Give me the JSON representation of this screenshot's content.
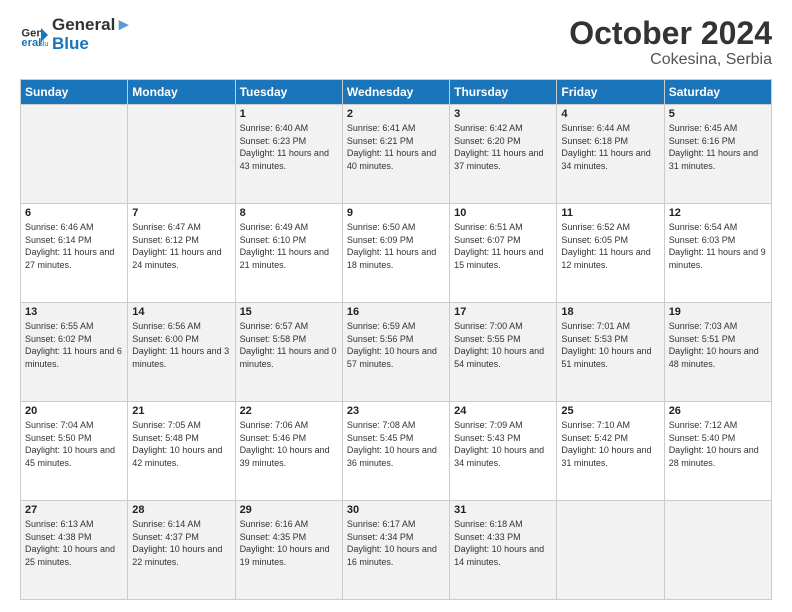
{
  "header": {
    "logo_general": "General",
    "logo_blue": "Blue",
    "month": "October 2024",
    "location": "Cokesina, Serbia"
  },
  "weekdays": [
    "Sunday",
    "Monday",
    "Tuesday",
    "Wednesday",
    "Thursday",
    "Friday",
    "Saturday"
  ],
  "weeks": [
    [
      {
        "day": "",
        "sunrise": "",
        "sunset": "",
        "daylight": ""
      },
      {
        "day": "",
        "sunrise": "",
        "sunset": "",
        "daylight": ""
      },
      {
        "day": "1",
        "sunrise": "Sunrise: 6:40 AM",
        "sunset": "Sunset: 6:23 PM",
        "daylight": "Daylight: 11 hours and 43 minutes."
      },
      {
        "day": "2",
        "sunrise": "Sunrise: 6:41 AM",
        "sunset": "Sunset: 6:21 PM",
        "daylight": "Daylight: 11 hours and 40 minutes."
      },
      {
        "day": "3",
        "sunrise": "Sunrise: 6:42 AM",
        "sunset": "Sunset: 6:20 PM",
        "daylight": "Daylight: 11 hours and 37 minutes."
      },
      {
        "day": "4",
        "sunrise": "Sunrise: 6:44 AM",
        "sunset": "Sunset: 6:18 PM",
        "daylight": "Daylight: 11 hours and 34 minutes."
      },
      {
        "day": "5",
        "sunrise": "Sunrise: 6:45 AM",
        "sunset": "Sunset: 6:16 PM",
        "daylight": "Daylight: 11 hours and 31 minutes."
      }
    ],
    [
      {
        "day": "6",
        "sunrise": "Sunrise: 6:46 AM",
        "sunset": "Sunset: 6:14 PM",
        "daylight": "Daylight: 11 hours and 27 minutes."
      },
      {
        "day": "7",
        "sunrise": "Sunrise: 6:47 AM",
        "sunset": "Sunset: 6:12 PM",
        "daylight": "Daylight: 11 hours and 24 minutes."
      },
      {
        "day": "8",
        "sunrise": "Sunrise: 6:49 AM",
        "sunset": "Sunset: 6:10 PM",
        "daylight": "Daylight: 11 hours and 21 minutes."
      },
      {
        "day": "9",
        "sunrise": "Sunrise: 6:50 AM",
        "sunset": "Sunset: 6:09 PM",
        "daylight": "Daylight: 11 hours and 18 minutes."
      },
      {
        "day": "10",
        "sunrise": "Sunrise: 6:51 AM",
        "sunset": "Sunset: 6:07 PM",
        "daylight": "Daylight: 11 hours and 15 minutes."
      },
      {
        "day": "11",
        "sunrise": "Sunrise: 6:52 AM",
        "sunset": "Sunset: 6:05 PM",
        "daylight": "Daylight: 11 hours and 12 minutes."
      },
      {
        "day": "12",
        "sunrise": "Sunrise: 6:54 AM",
        "sunset": "Sunset: 6:03 PM",
        "daylight": "Daylight: 11 hours and 9 minutes."
      }
    ],
    [
      {
        "day": "13",
        "sunrise": "Sunrise: 6:55 AM",
        "sunset": "Sunset: 6:02 PM",
        "daylight": "Daylight: 11 hours and 6 minutes."
      },
      {
        "day": "14",
        "sunrise": "Sunrise: 6:56 AM",
        "sunset": "Sunset: 6:00 PM",
        "daylight": "Daylight: 11 hours and 3 minutes."
      },
      {
        "day": "15",
        "sunrise": "Sunrise: 6:57 AM",
        "sunset": "Sunset: 5:58 PM",
        "daylight": "Daylight: 11 hours and 0 minutes."
      },
      {
        "day": "16",
        "sunrise": "Sunrise: 6:59 AM",
        "sunset": "Sunset: 5:56 PM",
        "daylight": "Daylight: 10 hours and 57 minutes."
      },
      {
        "day": "17",
        "sunrise": "Sunrise: 7:00 AM",
        "sunset": "Sunset: 5:55 PM",
        "daylight": "Daylight: 10 hours and 54 minutes."
      },
      {
        "day": "18",
        "sunrise": "Sunrise: 7:01 AM",
        "sunset": "Sunset: 5:53 PM",
        "daylight": "Daylight: 10 hours and 51 minutes."
      },
      {
        "day": "19",
        "sunrise": "Sunrise: 7:03 AM",
        "sunset": "Sunset: 5:51 PM",
        "daylight": "Daylight: 10 hours and 48 minutes."
      }
    ],
    [
      {
        "day": "20",
        "sunrise": "Sunrise: 7:04 AM",
        "sunset": "Sunset: 5:50 PM",
        "daylight": "Daylight: 10 hours and 45 minutes."
      },
      {
        "day": "21",
        "sunrise": "Sunrise: 7:05 AM",
        "sunset": "Sunset: 5:48 PM",
        "daylight": "Daylight: 10 hours and 42 minutes."
      },
      {
        "day": "22",
        "sunrise": "Sunrise: 7:06 AM",
        "sunset": "Sunset: 5:46 PM",
        "daylight": "Daylight: 10 hours and 39 minutes."
      },
      {
        "day": "23",
        "sunrise": "Sunrise: 7:08 AM",
        "sunset": "Sunset: 5:45 PM",
        "daylight": "Daylight: 10 hours and 36 minutes."
      },
      {
        "day": "24",
        "sunrise": "Sunrise: 7:09 AM",
        "sunset": "Sunset: 5:43 PM",
        "daylight": "Daylight: 10 hours and 34 minutes."
      },
      {
        "day": "25",
        "sunrise": "Sunrise: 7:10 AM",
        "sunset": "Sunset: 5:42 PM",
        "daylight": "Daylight: 10 hours and 31 minutes."
      },
      {
        "day": "26",
        "sunrise": "Sunrise: 7:12 AM",
        "sunset": "Sunset: 5:40 PM",
        "daylight": "Daylight: 10 hours and 28 minutes."
      }
    ],
    [
      {
        "day": "27",
        "sunrise": "Sunrise: 6:13 AM",
        "sunset": "Sunset: 4:38 PM",
        "daylight": "Daylight: 10 hours and 25 minutes."
      },
      {
        "day": "28",
        "sunrise": "Sunrise: 6:14 AM",
        "sunset": "Sunset: 4:37 PM",
        "daylight": "Daylight: 10 hours and 22 minutes."
      },
      {
        "day": "29",
        "sunrise": "Sunrise: 6:16 AM",
        "sunset": "Sunset: 4:35 PM",
        "daylight": "Daylight: 10 hours and 19 minutes."
      },
      {
        "day": "30",
        "sunrise": "Sunrise: 6:17 AM",
        "sunset": "Sunset: 4:34 PM",
        "daylight": "Daylight: 10 hours and 16 minutes."
      },
      {
        "day": "31",
        "sunrise": "Sunrise: 6:18 AM",
        "sunset": "Sunset: 4:33 PM",
        "daylight": "Daylight: 10 hours and 14 minutes."
      },
      {
        "day": "",
        "sunrise": "",
        "sunset": "",
        "daylight": ""
      },
      {
        "day": "",
        "sunrise": "",
        "sunset": "",
        "daylight": ""
      }
    ]
  ]
}
